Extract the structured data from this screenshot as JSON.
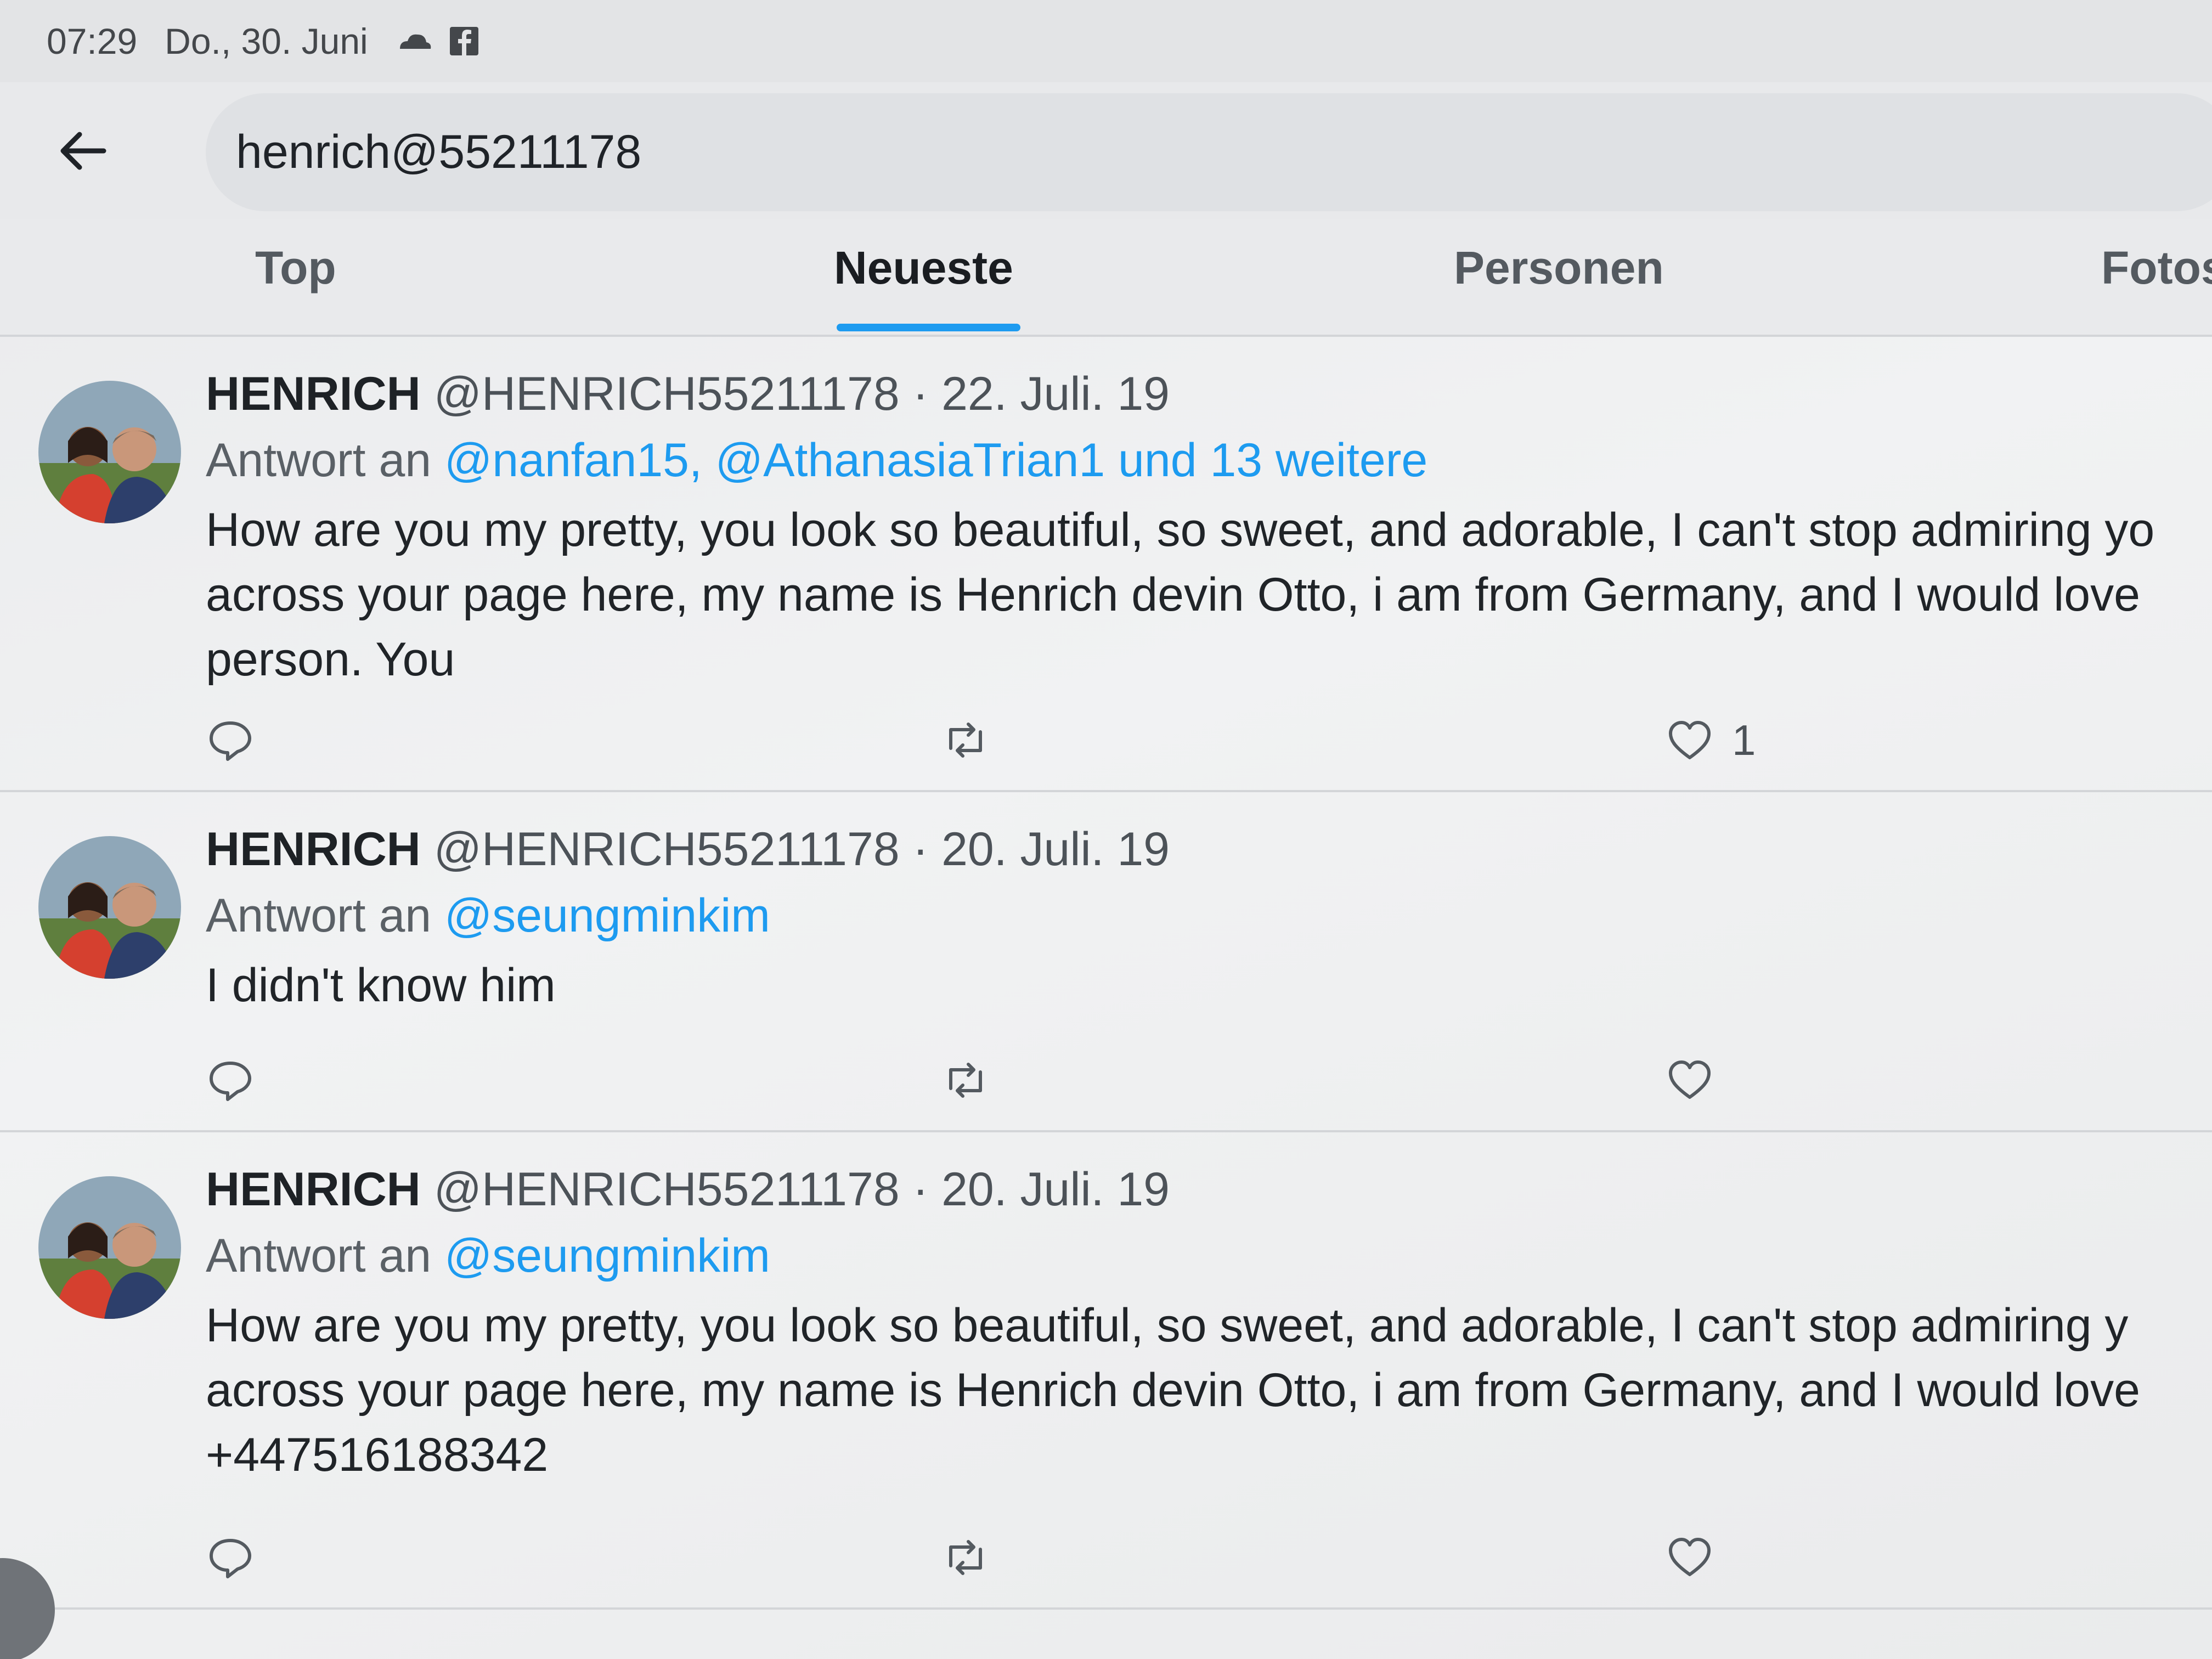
{
  "status_bar": {
    "time": "07:29",
    "date": "Do., 30. Juni"
  },
  "search": {
    "query": "henrich@55211178"
  },
  "tabs": [
    {
      "label": "Top",
      "active": false
    },
    {
      "label": "Neueste",
      "active": true
    },
    {
      "label": "Personen",
      "active": false
    },
    {
      "label": "Fotos",
      "active": false
    }
  ],
  "colors": {
    "accent": "#1d9bf0",
    "text": "#202428",
    "muted": "#5a6066"
  },
  "tweets": [
    {
      "name": "HENRICH",
      "meta": " @HENRICH55211178 · 22. Juli. 19",
      "reply_prefix": "Antwort an ",
      "reply_mentions": "@nanfan15, @AthanasiaTrian1 und 13 weitere",
      "text": "How are you my pretty, you look so beautiful, so sweet, and adorable, I can't stop admiring yo\nacross your page here, my name is Henrich devin Otto, i am from Germany, and I would love\nperson. You",
      "like_count": "1"
    },
    {
      "name": "HENRICH",
      "meta": " @HENRICH55211178 · 20. Juli. 19",
      "reply_prefix": "Antwort an ",
      "reply_mentions": "@seungminkim",
      "text": "I didn't know him",
      "like_count": ""
    },
    {
      "name": "HENRICH",
      "meta": " @HENRICH55211178 · 20. Juli. 19",
      "reply_prefix": "Antwort an ",
      "reply_mentions": "@seungminkim",
      "text": "How are you my pretty, you look so beautiful, so sweet, and adorable, I can't stop admiring y\nacross your page here, my name is Henrich devin Otto, i am from Germany, and I would love\n+447516188342",
      "like_count": ""
    }
  ]
}
